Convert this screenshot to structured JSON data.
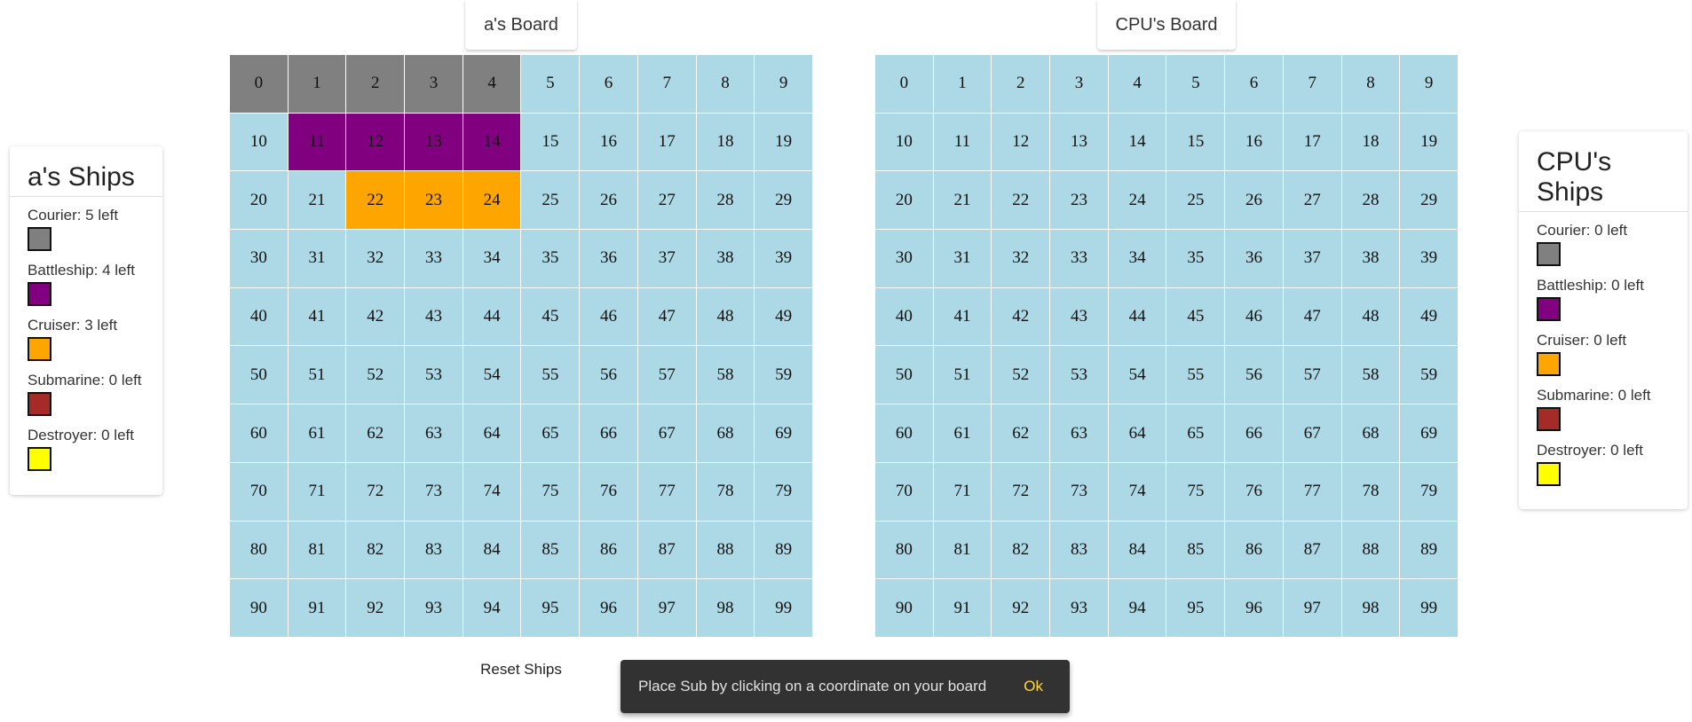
{
  "player": {
    "board_title": "a's Board",
    "ships_title": "a's Ships",
    "ships": [
      {
        "label": "Courier: 5 left",
        "color": "#808080"
      },
      {
        "label": "Battleship: 4 left",
        "color": "#800080"
      },
      {
        "label": "Cruiser: 3 left",
        "color": "#ffa500"
      },
      {
        "label": "Submarine: 0 left",
        "color": "#a52a2a"
      },
      {
        "label": "Destroyer: 0 left",
        "color": "#ffff00"
      }
    ],
    "placed": {
      "courier": [
        0,
        1,
        2,
        3,
        4
      ],
      "battleship": [
        11,
        12,
        13,
        14
      ],
      "cruiser": [
        22,
        23,
        24
      ]
    }
  },
  "cpu": {
    "board_title": "CPU's Board",
    "ships_title": "CPU's Ships",
    "ships": [
      {
        "label": "Courier: 0 left",
        "color": "#808080"
      },
      {
        "label": "Battleship: 0 left",
        "color": "#800080"
      },
      {
        "label": "Cruiser: 0 left",
        "color": "#ffa500"
      },
      {
        "label": "Submarine: 0 left",
        "color": "#a52a2a"
      },
      {
        "label": "Destroyer: 0 left",
        "color": "#ffff00"
      }
    ]
  },
  "grid": {
    "cells": [
      "0",
      "1",
      "2",
      "3",
      "4",
      "5",
      "6",
      "7",
      "8",
      "9",
      "10",
      "11",
      "12",
      "13",
      "14",
      "15",
      "16",
      "17",
      "18",
      "19",
      "20",
      "21",
      "22",
      "23",
      "24",
      "25",
      "26",
      "27",
      "28",
      "29",
      "30",
      "31",
      "32",
      "33",
      "34",
      "35",
      "36",
      "37",
      "38",
      "39",
      "40",
      "41",
      "42",
      "43",
      "44",
      "45",
      "46",
      "47",
      "48",
      "49",
      "50",
      "51",
      "52",
      "53",
      "54",
      "55",
      "56",
      "57",
      "58",
      "59",
      "60",
      "61",
      "62",
      "63",
      "64",
      "65",
      "66",
      "67",
      "68",
      "69",
      "70",
      "71",
      "72",
      "73",
      "74",
      "75",
      "76",
      "77",
      "78",
      "79",
      "80",
      "81",
      "82",
      "83",
      "84",
      "85",
      "86",
      "87",
      "88",
      "89",
      "90",
      "91",
      "92",
      "93",
      "94",
      "95",
      "96",
      "97",
      "98",
      "99"
    ],
    "water_color": "#add8e6"
  },
  "controls": {
    "reset_label": "Reset Ships"
  },
  "snackbar": {
    "message": "Place Sub by clicking on a coordinate on your board",
    "action": "Ok"
  }
}
